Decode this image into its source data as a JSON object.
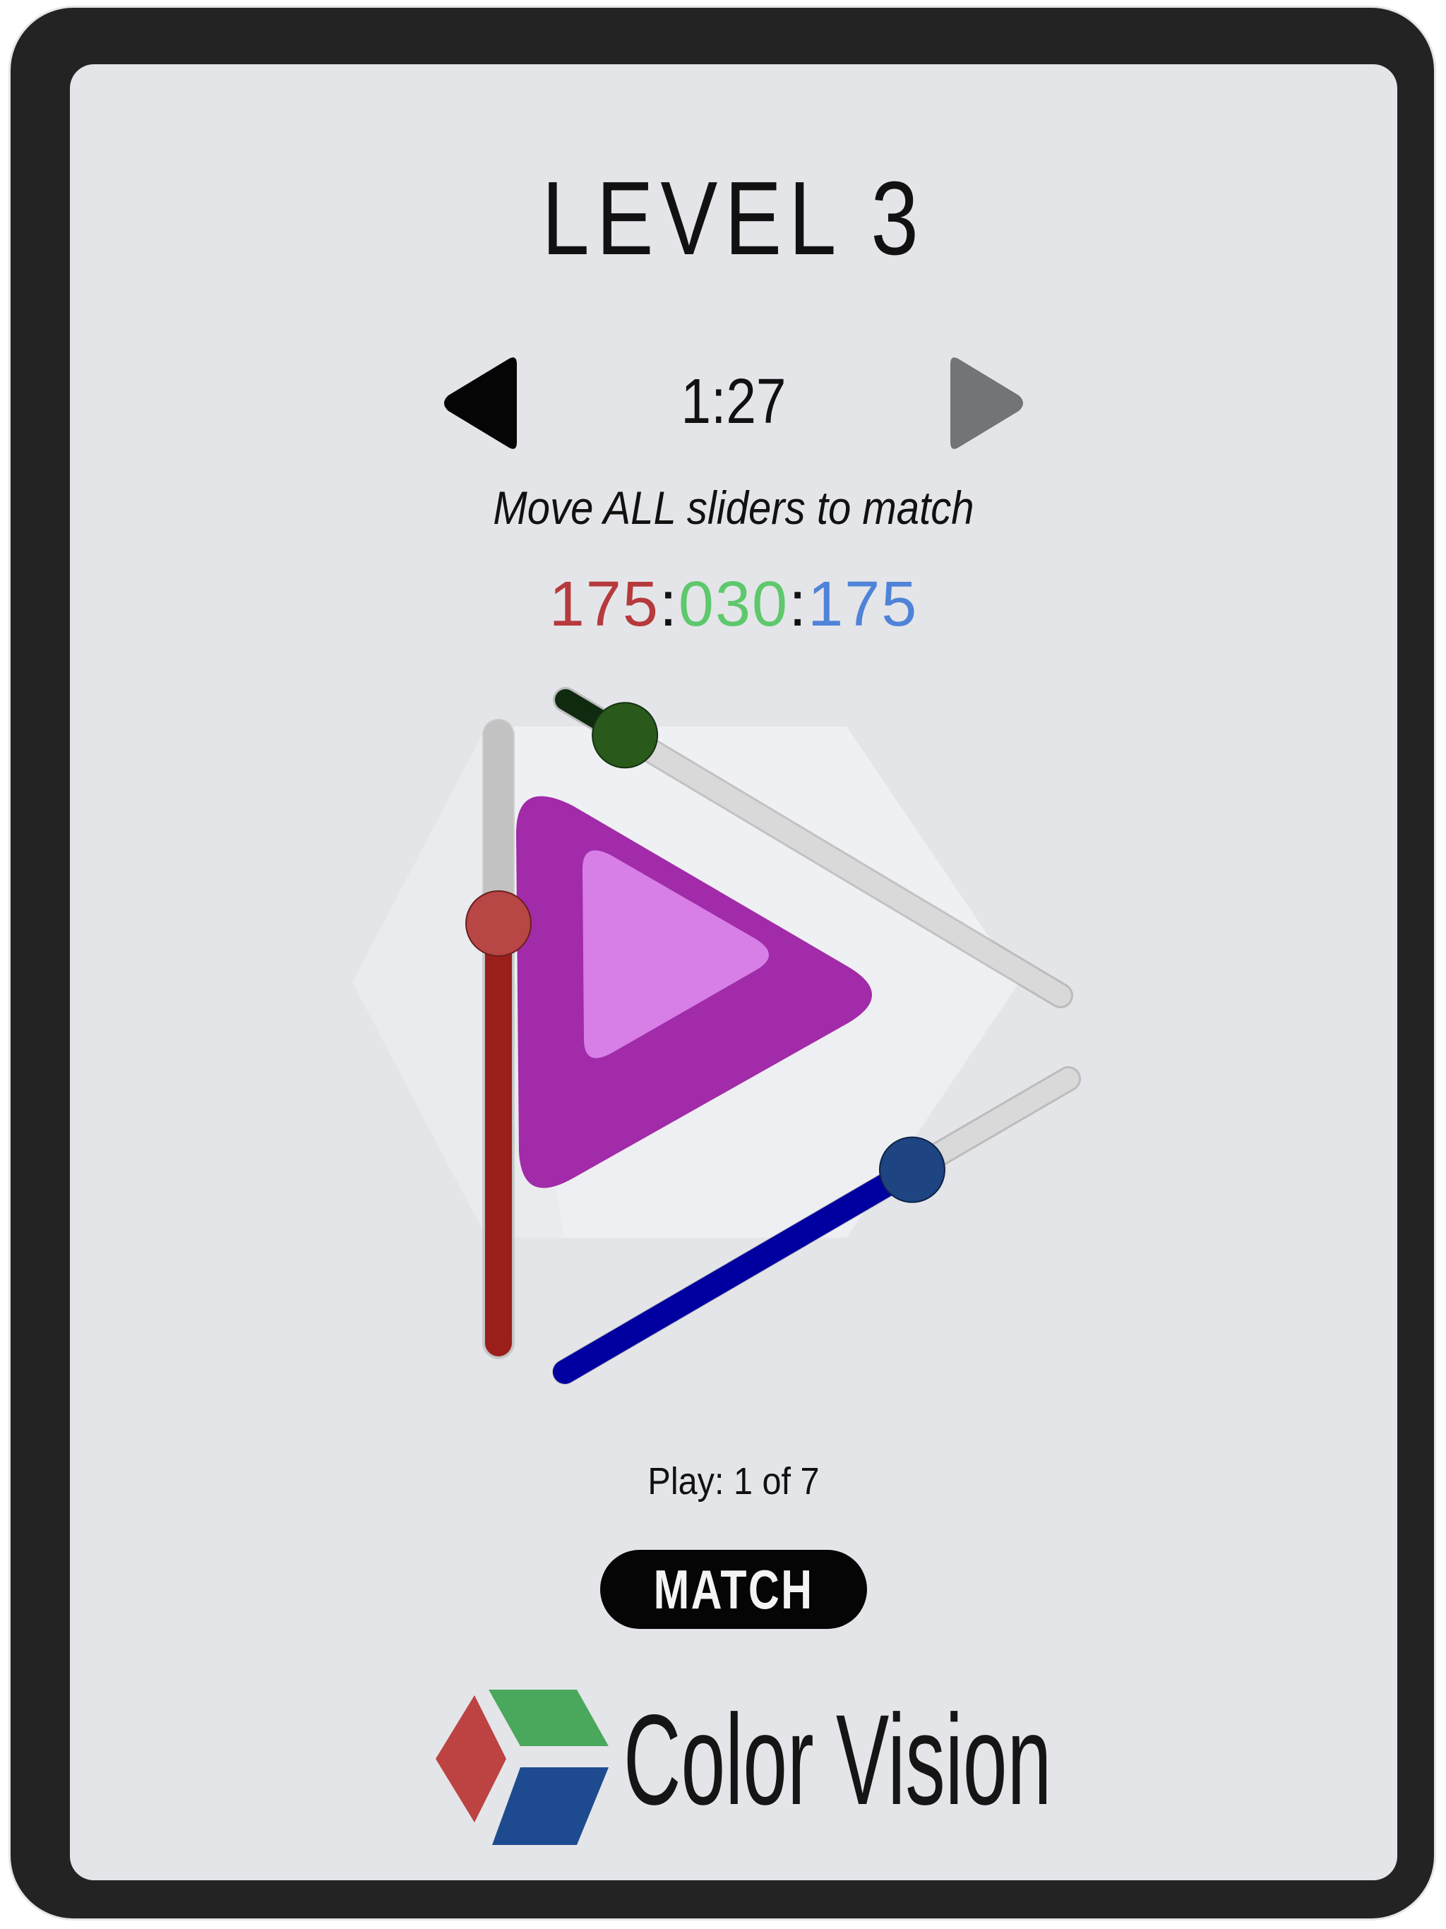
{
  "level": {
    "title": "LEVEL 3"
  },
  "timer": {
    "value": "1:27"
  },
  "navigation": {
    "prev_icon": "triangle-left-icon",
    "next_icon": "triangle-right-icon",
    "prev_enabled": true,
    "next_enabled": false,
    "prev_color": "#050505",
    "next_color": "#737476"
  },
  "instruction": "Move ALL sliders to match",
  "target": {
    "red": "175",
    "separator": ":",
    "green": "030",
    "blue": "175",
    "red_color": "#b63a3c",
    "green_color": "#5ec86c",
    "blue_color": "#4f83d8"
  },
  "sliders": [
    {
      "channel": "red",
      "fill_fraction": 0.69,
      "fill_color": "#9a1e1a",
      "knob_color": "#b84644"
    },
    {
      "channel": "green",
      "fill_fraction": 0.12,
      "fill_color": "#0f2a0f",
      "knob_color": "#2a5a1b"
    },
    {
      "channel": "blue",
      "fill_fraction": 0.69,
      "fill_color": "#0000a0",
      "knob_color": "#1e4482"
    }
  ],
  "preview": {
    "outer_color": "#a12ba8",
    "inner_color": "#d77ee7"
  },
  "play": {
    "label": "Play: 1 of 7"
  },
  "match_button": {
    "label": "MATCH"
  },
  "brand": {
    "name": "Color Vision",
    "logo_colors": [
      "#bd4343",
      "#4aa85c",
      "#1e4b8f"
    ]
  }
}
